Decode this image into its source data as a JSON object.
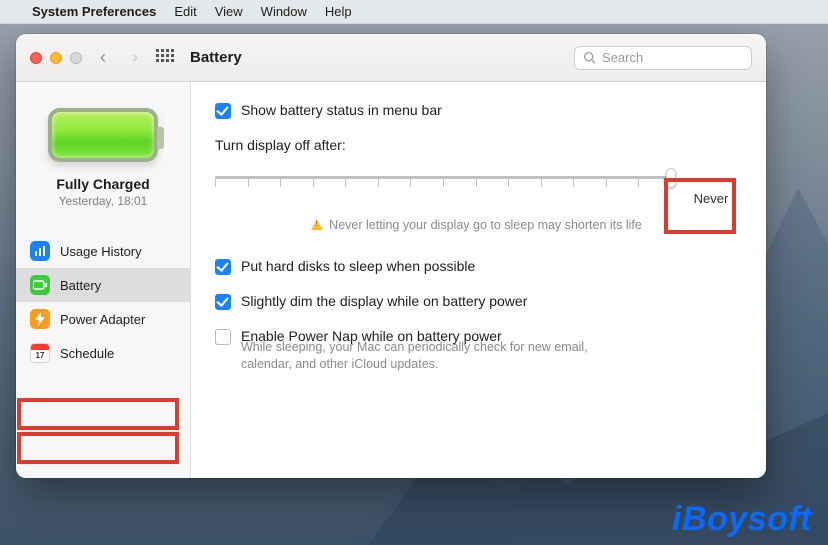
{
  "menubar": {
    "app": "System Preferences",
    "items": [
      "Edit",
      "View",
      "Window",
      "Help"
    ]
  },
  "window": {
    "title": "Battery",
    "search_placeholder": "Search"
  },
  "sidebar": {
    "status_title": "Fully Charged",
    "status_sub": "Yesterday, 18:01",
    "items": [
      {
        "icon": "chart-icon",
        "label": "Usage History"
      },
      {
        "icon": "battery-icon",
        "label": "Battery"
      },
      {
        "icon": "bolt-icon",
        "label": "Power Adapter"
      },
      {
        "icon": "calendar-icon",
        "label": "Schedule"
      }
    ]
  },
  "settings": {
    "show_in_menubar": "Show battery status in menu bar",
    "slider_label": "Turn display off after:",
    "slider_value_label": "Never",
    "slider_warning": "Never letting your display go to sleep may shorten its life",
    "hdd_sleep": "Put hard disks to sleep when possible",
    "dim_display": "Slightly dim the display while on battery power",
    "power_nap": "Enable Power Nap while on battery power",
    "power_nap_sub": "While sleeping, your Mac can periodically check for new email, calendar, and other iCloud updates."
  },
  "watermark": "iBoysoft"
}
